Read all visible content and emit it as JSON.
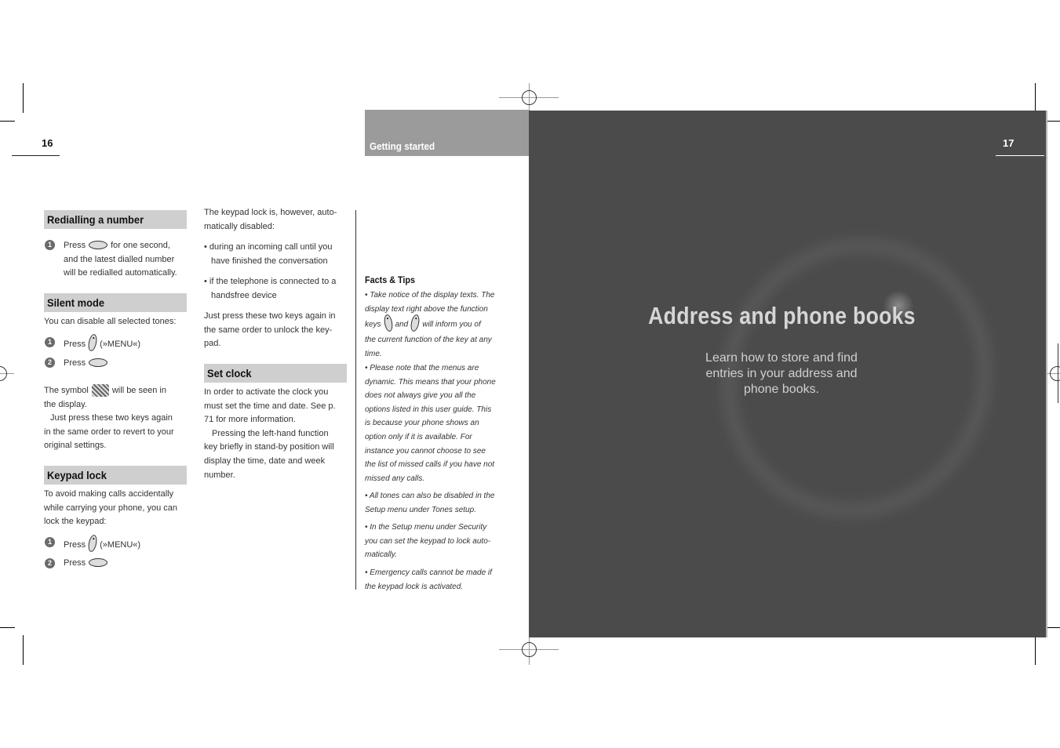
{
  "left_page": {
    "page_number": "16",
    "sections": {
      "redial": {
        "heading": "Redialling a number",
        "steps": [
          {
            "num": "1",
            "pre": "Press",
            "key_icon": "zero-plus-key-icon",
            "post": "for one second,",
            "lines": [
              "and the latest dialled number",
              "will be redialled automatically."
            ]
          }
        ]
      },
      "silent": {
        "heading": "Silent mode",
        "intro": "You can disable all selected tones:",
        "steps": [
          {
            "num": "1",
            "pre": "Press",
            "key_icon": "right-softkey-icon",
            "post": "(»MENU«)"
          },
          {
            "num": "2",
            "pre": "Press",
            "key_icon": "star-key-icon",
            "post": ""
          }
        ],
        "symbol_pre": "The symbol",
        "symbol_icon": "silent-symbol-icon",
        "symbol_post": "will be seen in",
        "symbol_line2": "the display.",
        "revert": [
          "Just press these two keys again",
          "in the same order to revert to your",
          "original settings."
        ]
      },
      "keypad": {
        "heading": "Keypad lock",
        "intro": [
          "To avoid making calls accidentally",
          "while carrying your phone, you can",
          "lock the keypad:"
        ],
        "steps": [
          {
            "num": "1",
            "pre": "Press",
            "key_icon": "right-softkey-icon",
            "post": "(»MENU«)"
          },
          {
            "num": "2",
            "pre": "Press",
            "key_icon": "hash-key-icon",
            "post": ""
          }
        ]
      }
    },
    "col2": {
      "intro": [
        "The keypad lock is, however, auto-",
        "matically disabled:"
      ],
      "bullets": [
        [
          "• during an incoming call until you",
          "have finished the conversation"
        ],
        [
          "• if the telephone is connected to a",
          "handsfree device"
        ]
      ],
      "unlock": [
        "Just press these two keys again in",
        "the same order to unlock the key-",
        "pad."
      ],
      "clock": {
        "heading": "Set clock",
        "para1": [
          "In order to activate the clock you",
          "must set the time and date. See p.",
          "71 for more information."
        ],
        "para2": [
          "Pressing the left-hand function",
          "key briefly in stand-by position will",
          "display the time, date and week",
          "number."
        ]
      }
    },
    "facts": {
      "heading": "Facts & Tips",
      "tip1": {
        "line1": "• Take notice of the display texts. The",
        "line2": "display text right above the function",
        "line3_pre": "keys",
        "line3_mid": "and",
        "line3_post": "will inform you of",
        "line4": "the current function of the key at any",
        "line5": "time."
      },
      "tips": [
        [
          "• Please note that the menus are",
          "dynamic. This means that your phone",
          "does not always give you all the",
          "options listed in this user guide. This",
          "is because your phone shows an",
          "option only if it is available. For",
          "instance you cannot choose to see",
          "the list of missed calls if you have not",
          "missed any calls."
        ],
        [
          "• All tones can also be disabled in the",
          "Setup menu under Tones setup."
        ],
        [
          "• In the Setup menu under Security",
          "you can set the keypad to lock auto-",
          "matically."
        ],
        [
          "• Emergency calls cannot be made if",
          "the keypad lock is activated."
        ]
      ]
    },
    "section_band": "Getting started"
  },
  "right_page": {
    "page_number": "17",
    "chapter_title": "Address and phone books",
    "chapter_subtitle": [
      "Learn how to store and find",
      "entries in your address and",
      "phone books."
    ],
    "colors": {
      "panel": "#4b4b4b",
      "band": "#9b9b9b",
      "heading_bg": "#cfcfcf"
    }
  }
}
